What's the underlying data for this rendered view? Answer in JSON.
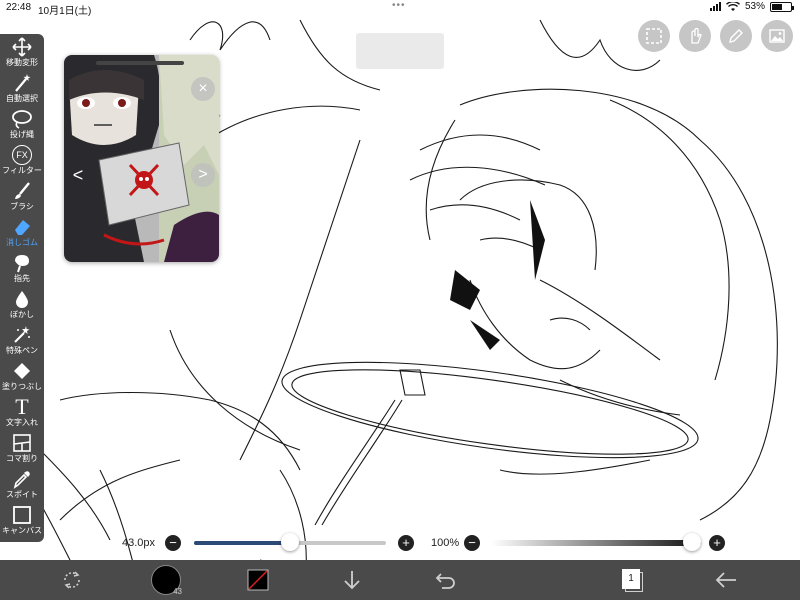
{
  "status_bar": {
    "time": "22:48",
    "date": "10月1日(土)",
    "battery_percent": 53,
    "battery_label": "53%"
  },
  "toolbar": {
    "tools": [
      {
        "label": "移動変形",
        "icon": "move-transform-icon"
      },
      {
        "label": "自動選択",
        "icon": "magic-wand-icon"
      },
      {
        "label": "投げ縄",
        "icon": "lasso-icon"
      },
      {
        "label": "フィルター",
        "icon": "fx-icon",
        "icon_text": "FX"
      },
      {
        "label": "ブラシ",
        "icon": "brush-icon"
      },
      {
        "label": "消しゴム",
        "icon": "eraser-icon",
        "active": true
      },
      {
        "label": "指先",
        "icon": "finger-smudge-icon"
      },
      {
        "label": "ぼかし",
        "icon": "blur-drop-icon"
      },
      {
        "label": "特殊ペン",
        "icon": "special-pen-icon"
      },
      {
        "label": "塗りつぶし",
        "icon": "fill-bucket-icon"
      },
      {
        "label": "文字入れ",
        "icon": "text-icon",
        "icon_text": "T"
      },
      {
        "label": "コマ割り",
        "icon": "frame-divider-icon"
      },
      {
        "label": "スポイト",
        "icon": "eyedropper-icon"
      },
      {
        "label": "キャンバス",
        "icon": "canvas-icon"
      }
    ],
    "active_color": "#4fa7ff"
  },
  "top_actions": [
    "selection-icon",
    "hand-icon",
    "pen-icon",
    "image-icon"
  ],
  "reference_window": {
    "prev_icon": "<",
    "next_icon": ">",
    "close_icon": "close-icon"
  },
  "brush": {
    "size_label": "43.0px",
    "size_fraction": 0.5
  },
  "opacity": {
    "label": "100%",
    "fraction": 1.0
  },
  "bottom_bar": {
    "items": [
      "transform-icon",
      "brush-size-icon",
      "color-icon",
      "save-down-icon",
      "undo-icon",
      "layers-icon",
      "back-icon"
    ],
    "brush_size_badge": "43",
    "layer_count": "1",
    "bar_color": "#4a4a4a"
  }
}
